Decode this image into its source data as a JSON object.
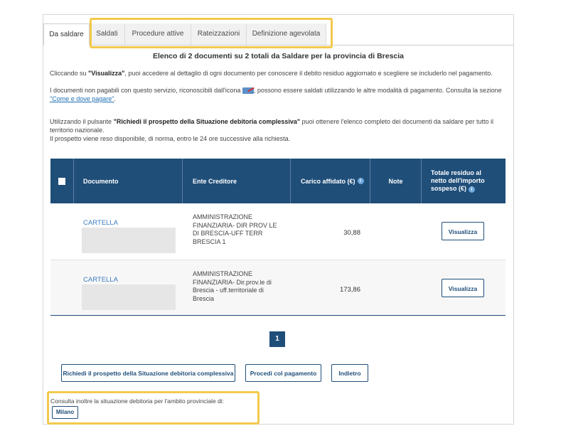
{
  "tabs": [
    {
      "label": "Da saldare",
      "active": true
    },
    {
      "label": "Saldati",
      "active": false
    },
    {
      "label": "Procedure attive",
      "active": false
    },
    {
      "label": "Rateizzazioni",
      "active": false
    },
    {
      "label": "Definizione agevolata",
      "active": false
    }
  ],
  "heading": "Elenco di 2 documenti su 2 totali da Saldare per la provincia di Brescia",
  "intro": {
    "p1_a": "Cliccando su ",
    "p1_b": "\"Visualizza\"",
    "p1_c": ", puoi accedere al dettaglio di ogni documento per conoscere il debito residuo aggiornato e scegliere se includerlo nel pagamento.",
    "p2_a": "I documenti non pagabili con questo servizio, riconoscibili dall'icona ",
    "p2_b": ", possono essere saldati utilizzando le altre modalità di pagamento. Consulta la sezione ",
    "p2_link": "\"Come e dove pagare\"",
    "p2_c": ".",
    "p3_a": "Utilizzando il pulsante ",
    "p3_b": "\"Richiedi il prospetto della Situazione debitoria complessiva\"",
    "p3_c": " puoi ottenere l'elenco completo dei documenti da saldare per tutto il territorio nazionale.",
    "p4": "Il prospetto viene reso disponibile, di norma, entro le 24 ore successive alla richiesta."
  },
  "table": {
    "headers": {
      "documento": "Documento",
      "ente": "Ente Creditore",
      "carico": "Carico affidato (€)",
      "note": "Note",
      "totale": "Totale residuo al netto dell'importo sospeso (€)"
    },
    "rows": [
      {
        "documento": "CARTELLA",
        "ente": "AMMINISTRAZIONE FINANZIARIA- DIR PROV LE DI BRESCIA-UFF TERR BRESCIA 1",
        "carico": "30,88",
        "note": "",
        "action": "Visualizza"
      },
      {
        "documento": "CARTELLA",
        "ente": "AMMINISTRAZIONE FINANZIARIA- Dir.prov.le di Brescia - uff.territoriale di Brescia",
        "carico": "173,86",
        "note": "",
        "action": "Visualizza"
      }
    ]
  },
  "pagination": {
    "current": "1"
  },
  "buttons": {
    "richiedi": "Richiedi il prospetto della Situazione debitoria complessiva",
    "procedi": "Procedi col pagamento",
    "indietro": "Indietro"
  },
  "footer": {
    "text": "Consulta inoltre la situazione debitoria per l'ambito provinciale di:",
    "milano": "Milano"
  },
  "colors": {
    "primary": "#1f4e79",
    "highlight": "#f2c94c",
    "link": "#3a7cbf"
  }
}
